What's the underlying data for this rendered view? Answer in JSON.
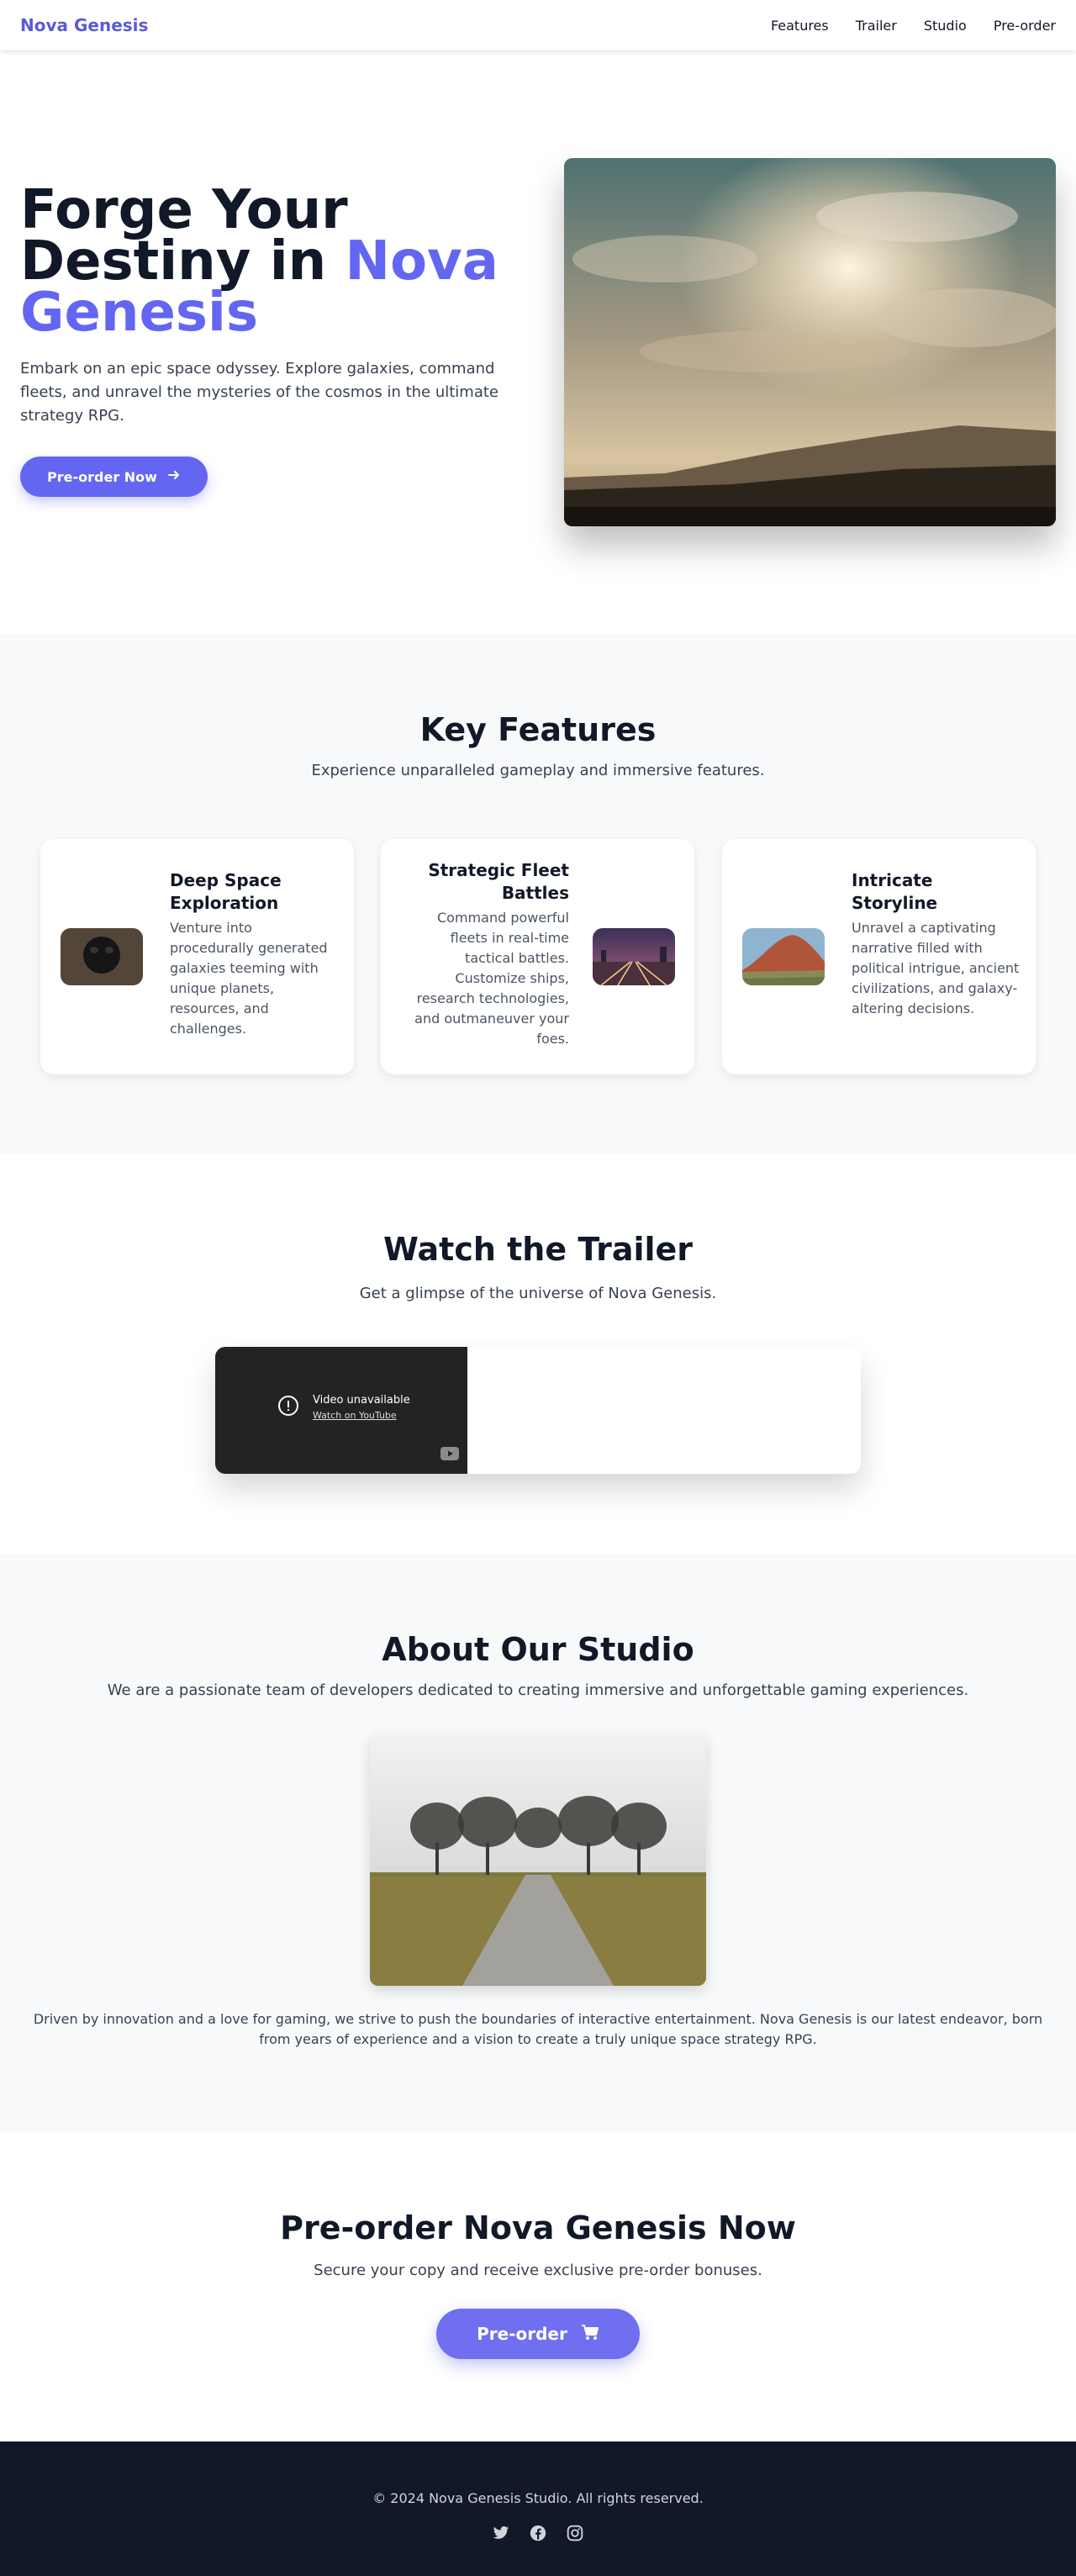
{
  "nav": {
    "brand": "Nova Genesis",
    "links": [
      "Features",
      "Trailer",
      "Studio",
      "Pre-order"
    ]
  },
  "hero": {
    "title_part1": "Forge Your Destiny in ",
    "title_accent": "Nova Genesis",
    "text": "Embark on an epic space odyssey. Explore galaxies, command fleets, and unravel the mysteries of the cosmos in the ultimate strategy RPG.",
    "cta_label": "Pre-order Now",
    "cta_icon": "arrow-right-icon"
  },
  "features": {
    "title": "Key Features",
    "subtitle": "Experience unparalleled gameplay and immersive features.",
    "cards": [
      {
        "title": "Deep Space Exploration",
        "desc": "Venture into procedurally generated galaxies teeming with unique planets, resources, and challenges."
      },
      {
        "title": "Strategic Fleet Battles",
        "desc": "Command powerful fleets in real-time tactical battles. Customize ships, research technologies, and outmaneuver your foes."
      },
      {
        "title": "Intricate Storyline",
        "desc": "Unravel a captivating narrative filled with political intrigue, ancient civilizations, and galaxy-altering decisions."
      }
    ]
  },
  "trailer": {
    "title": "Watch the Trailer",
    "subtitle": "Get a glimpse of the universe of Nova Genesis.",
    "video_unavailable": "Video unavailable",
    "watch_on_youtube": "Watch on YouTube"
  },
  "about": {
    "title": "About Our Studio",
    "subtitle": "We are a passionate team of developers dedicated to creating immersive and unforgettable gaming experiences.",
    "text": "Driven by innovation and a love for gaming, we strive to push the boundaries of interactive entertainment. Nova Genesis is our latest endeavor, born from years of experience and a vision to create a truly unique space strategy RPG."
  },
  "preorder": {
    "title": "Pre-order Nova Genesis Now",
    "subtitle": "Secure your copy and receive exclusive pre-order bonuses.",
    "button_label": "Pre-order",
    "button_icon": "cart-icon"
  },
  "footer": {
    "copyright": "© 2024 Nova Genesis Studio. All rights reserved.",
    "social": [
      "twitter-icon",
      "facebook-icon",
      "instagram-icon"
    ]
  },
  "colors": {
    "accent": "#6366f1",
    "dark": "#111827",
    "light_bg": "#f8f9fb"
  }
}
